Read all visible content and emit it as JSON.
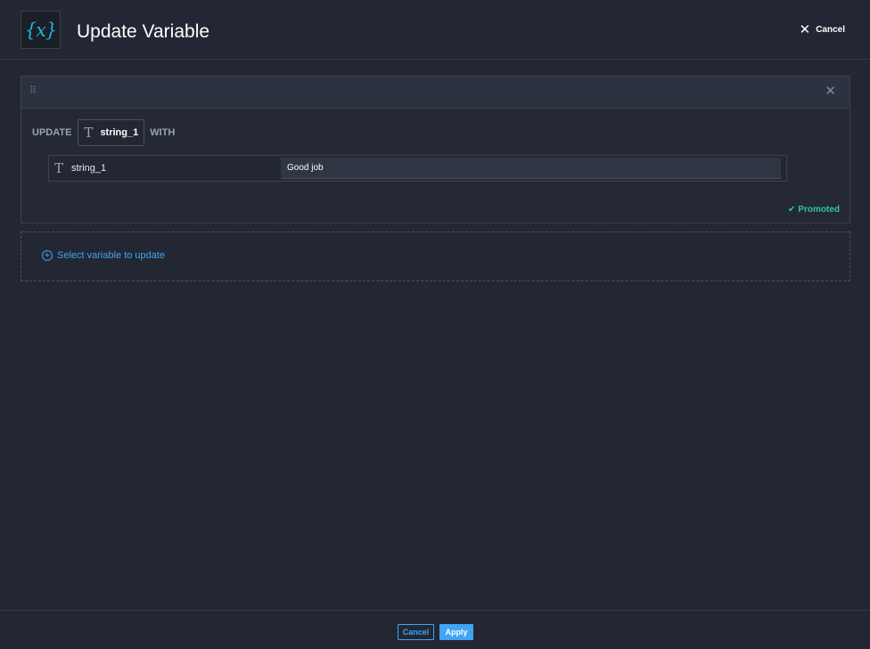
{
  "header": {
    "icon_text": "{x}",
    "title": "Update Variable",
    "cancel_label": "Cancel"
  },
  "card": {
    "update_label": "UPDATE",
    "variable_type_icon": "T",
    "variable_name": "string_1",
    "with_label": "WITH",
    "assignments": [
      {
        "type_icon": "T",
        "name": "string_1",
        "value": "Good job"
      }
    ],
    "status_text": "Promoted",
    "status_color": "#34c59a"
  },
  "add_variable": {
    "label": "Select variable to update"
  },
  "footer": {
    "cancel_label": "Cancel",
    "apply_label": "Apply"
  },
  "colors": {
    "background": "#232733",
    "accent": "#3fa5f4",
    "icon_accent": "#1fb3d1"
  }
}
